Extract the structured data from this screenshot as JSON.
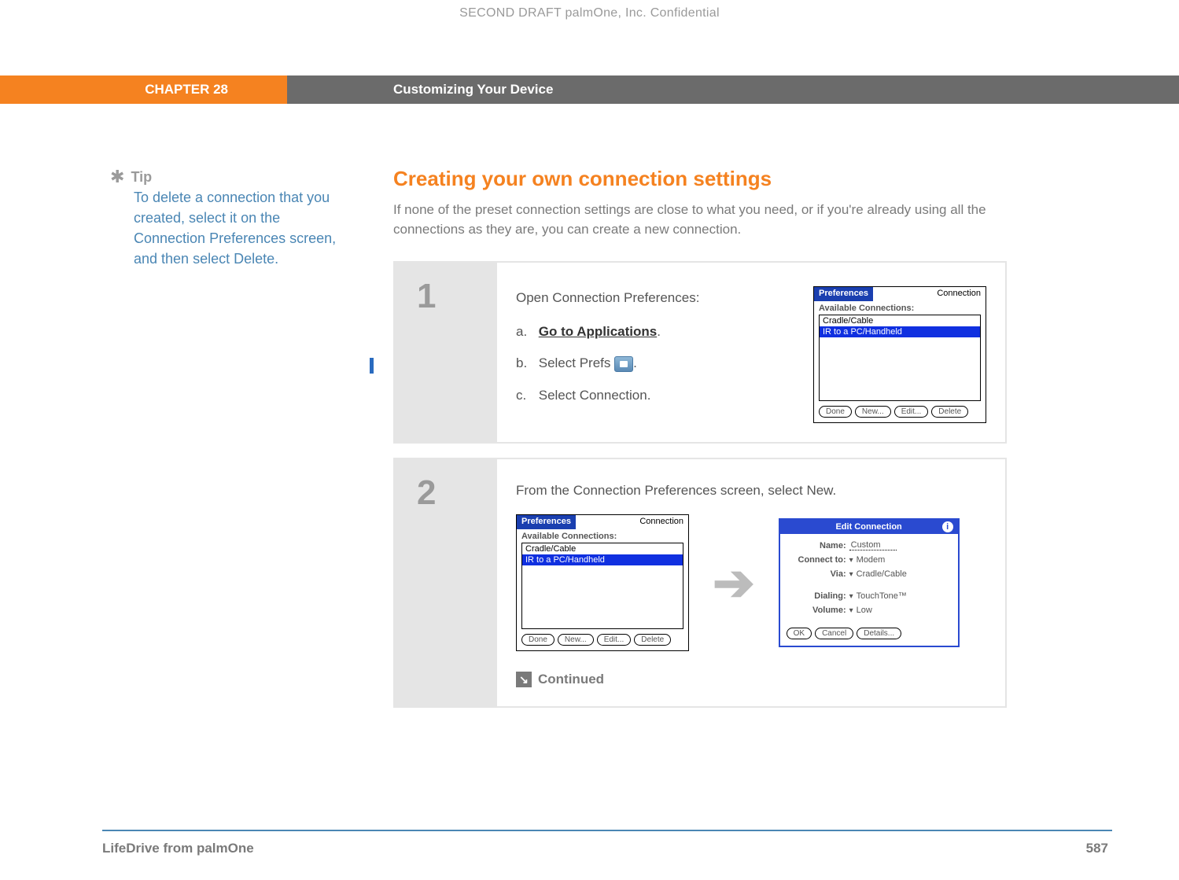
{
  "confidential": "SECOND DRAFT palmOne, Inc.  Confidential",
  "header": {
    "chapter": "CHAPTER 28",
    "title": "Customizing Your Device"
  },
  "tip": {
    "label": "Tip",
    "body": "To delete a connection that you created, select it on the Connection Preferences screen, and then select Delete."
  },
  "section": {
    "heading": "Creating your own connection settings",
    "intro": "If none of the preset connection settings are close to what you need, or if you're already using all the connections as they are, you can create a new connection."
  },
  "step1": {
    "num": "1",
    "intro": "Open Connection Preferences:",
    "a_letter": "a.",
    "a_link": "Go to Applications",
    "a_suffix": ".",
    "b_letter": "b.",
    "b_text_pre": "Select Prefs ",
    "b_text_post": ".",
    "c_letter": "c.",
    "c_text": "Select Connection.",
    "palm": {
      "title_left": "Preferences",
      "title_right": "Connection",
      "subtitle": "Available Connections:",
      "items": [
        "Cradle/Cable",
        "IR to a PC/Handheld"
      ],
      "selected_index": 1,
      "buttons": [
        "Done",
        "New...",
        "Edit...",
        "Delete"
      ]
    }
  },
  "step2": {
    "num": "2",
    "text": "From the Connection Preferences screen, select New.",
    "palm_left": {
      "title_left": "Preferences",
      "title_right": "Connection",
      "subtitle": "Available Connections:",
      "items": [
        "Cradle/Cable",
        "IR to a PC/Handheld"
      ],
      "selected_index": 1,
      "buttons": [
        "Done",
        "New...",
        "Edit...",
        "Delete"
      ]
    },
    "palm_right": {
      "title": "Edit Connection",
      "name_label": "Name:",
      "name_value": "Custom",
      "connect_label": "Connect to:",
      "connect_value": "Modem",
      "via_label": "Via:",
      "via_value": "Cradle/Cable",
      "dialing_label": "Dialing:",
      "dialing_value": "TouchTone™",
      "volume_label": "Volume:",
      "volume_value": "Low",
      "buttons": [
        "OK",
        "Cancel",
        "Details..."
      ]
    },
    "continued": "Continued"
  },
  "footer": {
    "left": "LifeDrive from palmOne",
    "page": "587"
  }
}
